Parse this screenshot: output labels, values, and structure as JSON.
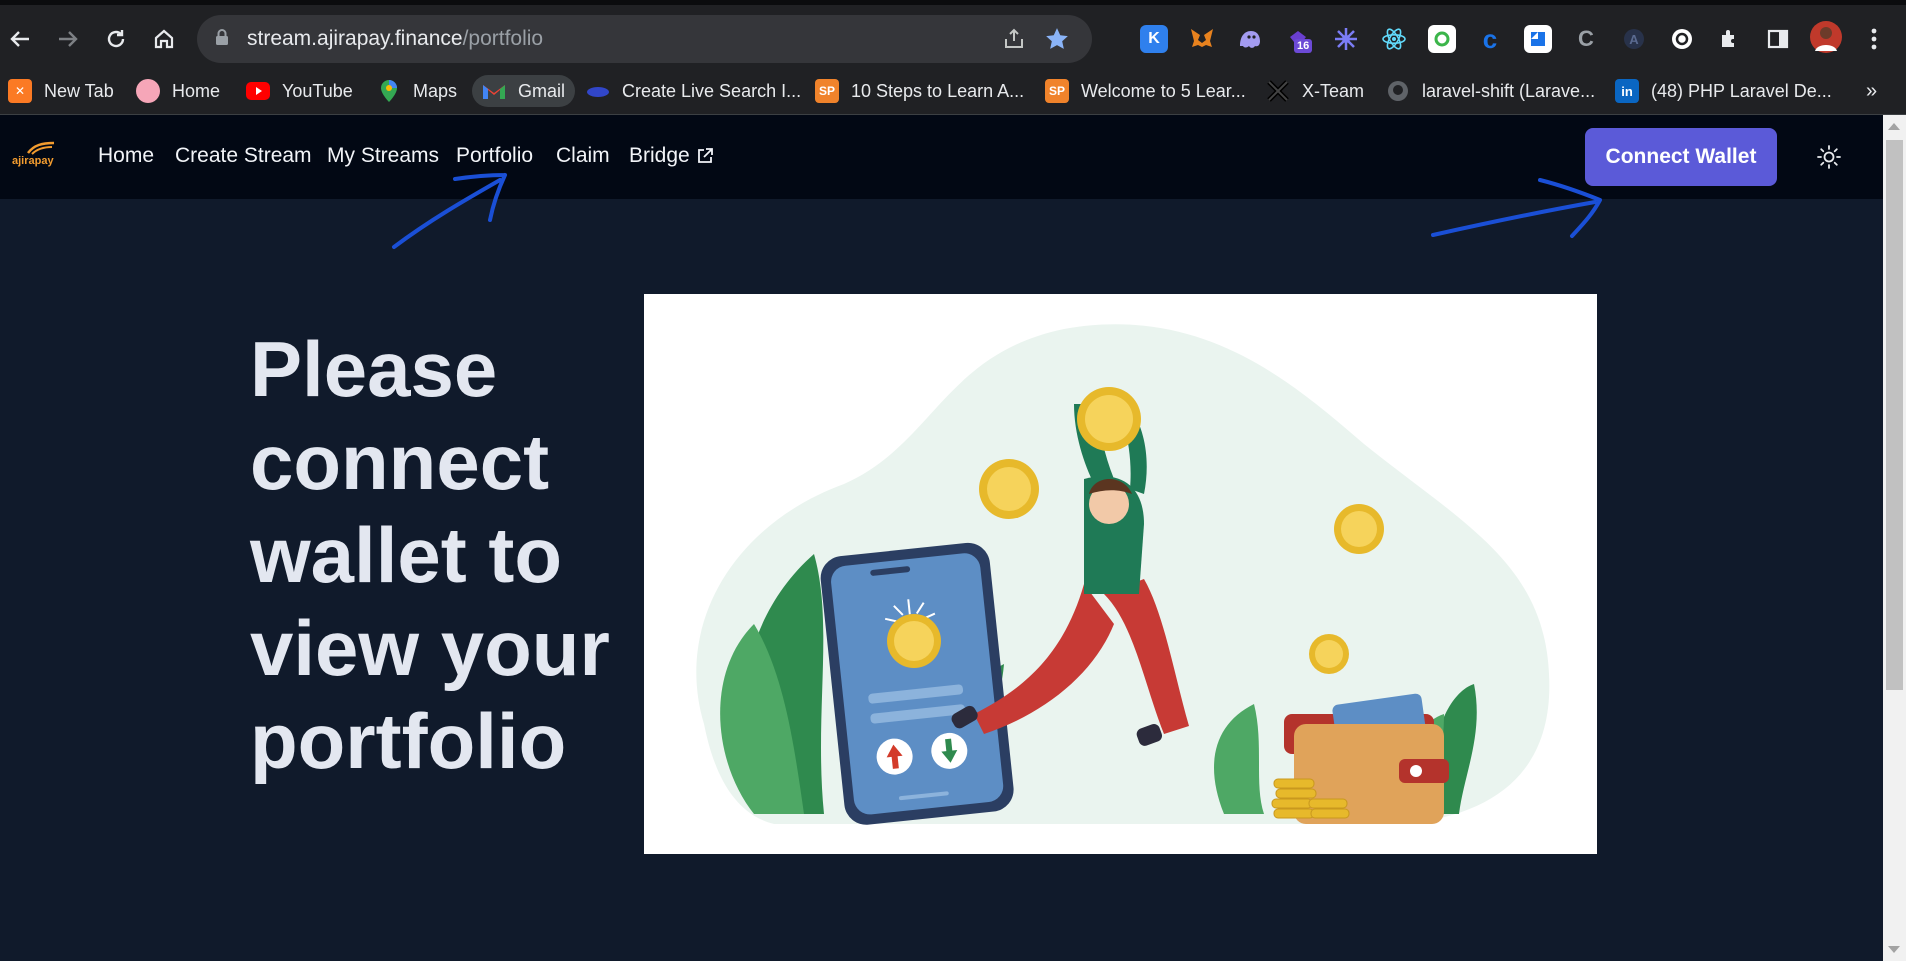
{
  "browser": {
    "url_host": "stream.ajirapay.finance",
    "url_path": "/portfolio",
    "extension_badge": "16",
    "bookmarks": [
      {
        "label": "New Tab",
        "icon": "xampp-icon"
      },
      {
        "label": "Home",
        "icon": "pig-icon"
      },
      {
        "label": "YouTube",
        "icon": "youtube-icon"
      },
      {
        "label": "Maps",
        "icon": "maps-icon"
      },
      {
        "label": "Gmail",
        "icon": "gmail-icon"
      },
      {
        "label": "Create Live Search I...",
        "icon": "cloud-icon"
      },
      {
        "label": "10 Steps to Learn A...",
        "icon": "sp-icon"
      },
      {
        "label": "Welcome to 5 Lear...",
        "icon": "sp-icon"
      },
      {
        "label": "X-Team",
        "icon": "x-icon"
      },
      {
        "label": "laravel-shift (Larave...",
        "icon": "github-icon"
      },
      {
        "label": "(48) PHP Laravel De...",
        "icon": "linkedin-icon"
      }
    ],
    "bookmarks_overflow": "»"
  },
  "site": {
    "logo_text": "ajirapay",
    "nav": {
      "home": "Home",
      "create_stream": "Create Stream",
      "my_streams": "My Streams",
      "portfolio": "Portfolio",
      "claim": "Claim",
      "bridge": "Bridge"
    },
    "connect_wallet": "Connect Wallet"
  },
  "main": {
    "headline": "Please connect wallet to view your portfolio"
  },
  "colors": {
    "page_bg": "#101a2b",
    "header_bg": "#020814",
    "accent": "#5b5ad8",
    "annotation_arrows": "#1a4fd6"
  }
}
